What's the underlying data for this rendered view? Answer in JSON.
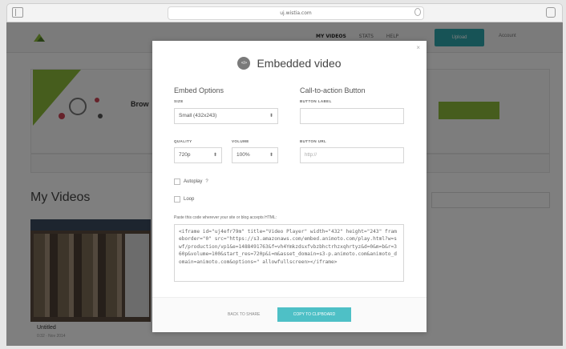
{
  "browser": {
    "url": "uj.wistia.com"
  },
  "page": {
    "nav": [
      "MY VIDEOS",
      "STATS",
      "HELP"
    ],
    "upload_label": "Upload",
    "account_label": "Account",
    "promo_title": "Brow",
    "my_videos_title": "My Videos",
    "thumb_title": "Untitled",
    "thumb_meta": "0:32 · Nov 2014"
  },
  "modal": {
    "close": "×",
    "icon_label": "</>",
    "title": "Embedded video",
    "embed_options_title": "Embed Options",
    "cta_title": "Call-to-action Button",
    "size_label": "SIZE",
    "size_value": "Small (432x243)",
    "quality_label": "QUALITY",
    "quality_value": "720p",
    "volume_label": "VOLUME",
    "volume_value": "100%",
    "button_label_label": "BUTTON LABEL",
    "button_label_value": "",
    "button_url_label": "BUTTON URL",
    "button_url_placeholder": "http://",
    "autoplay_label": "Autoplay",
    "autoplay_help": "?",
    "loop_label": "Loop",
    "paste_instruction": "Paste this code wherever your site or blog accepts HTML:",
    "embed_code": "<iframe id=\"uj4efr79m\" title=\"Video Player\" width=\"432\" height=\"243\" frameborder=\"0\" src=\"https://s3.amazonaws.com/embed.animoto.com/play.html?w=swf/production/vp1&e=1488491763&f=vh4Ymkzdsxfvbzbhctrhzxqhrtyz&d=0&m=b&r=360p&volume=100&start_res=720p&i=m&asset_domain=s3-p.animoto.com&animoto_domain=animoto.com&options=\" allowfullscreen></iframe>",
    "back_label": "BACK TO SHARE",
    "copy_label": "COPY TO CLIPBOARD"
  },
  "colors": {
    "overlay": "#000000",
    "accent_teal": "#4ec0c6",
    "promo_green": "#8cbb3b"
  }
}
